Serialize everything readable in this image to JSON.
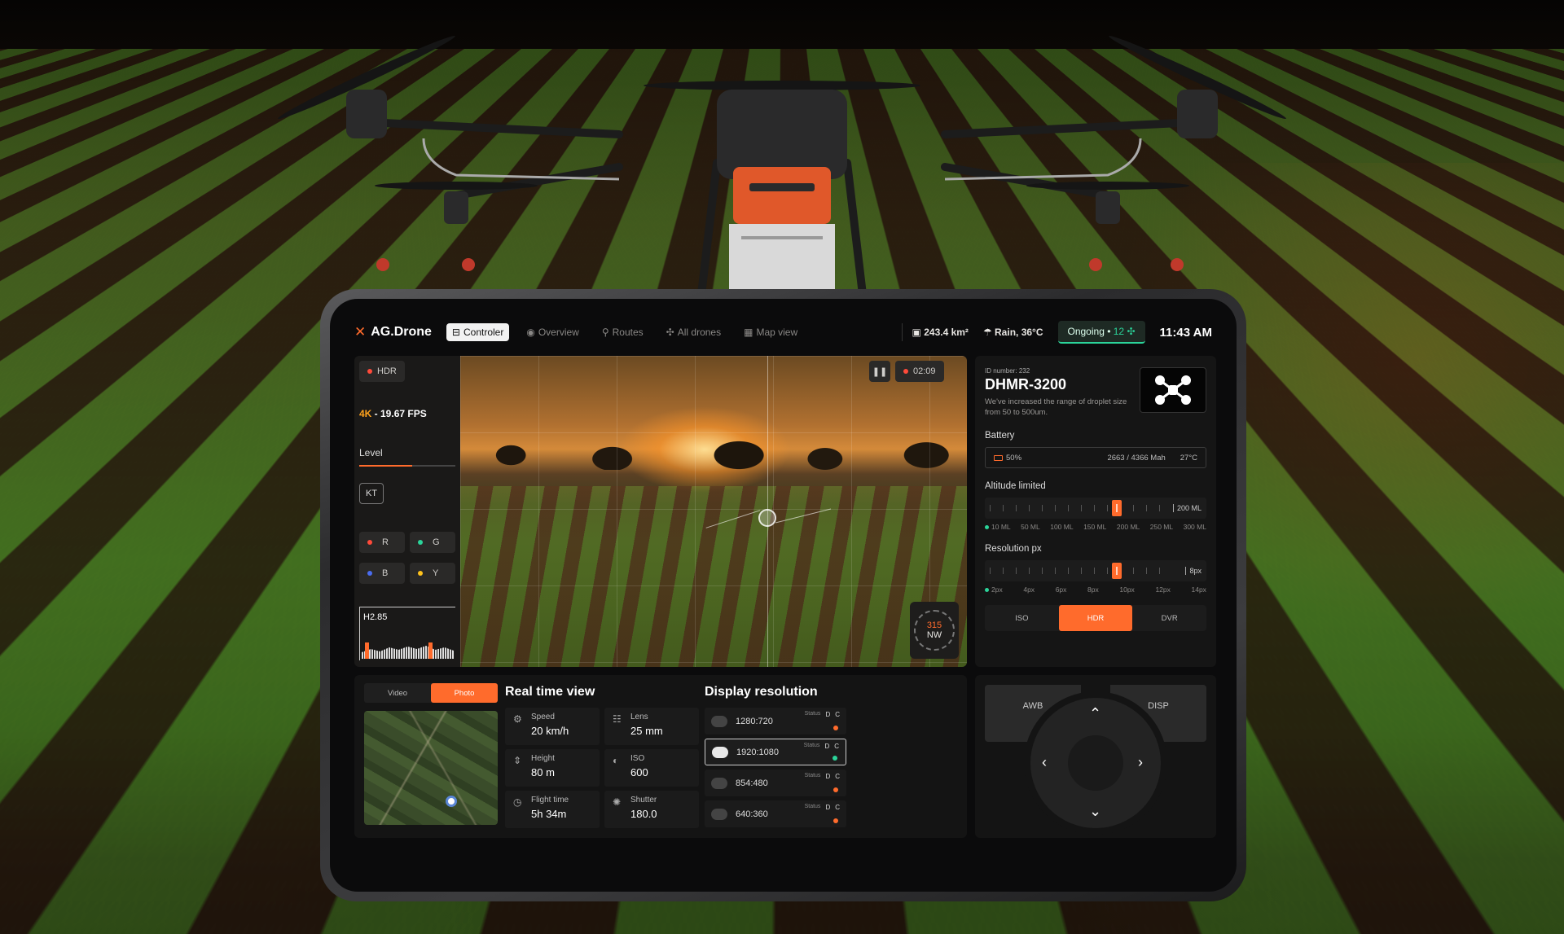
{
  "app": {
    "logo": "AG.Drone"
  },
  "nav": [
    {
      "label": "Controler",
      "icon": "gamepad-icon",
      "active": true
    },
    {
      "label": "Overview",
      "icon": "eye-icon"
    },
    {
      "label": "Routes",
      "icon": "route-icon"
    },
    {
      "label": "All drones",
      "icon": "drone-icon"
    },
    {
      "label": "Map view",
      "icon": "map-icon"
    }
  ],
  "status": {
    "area": "243.4 km²",
    "weather": "Rain, 36°C",
    "ongoing_label": "Ongoing •",
    "ongoing_count": "12",
    "time": "11:43 AM"
  },
  "camera": {
    "hdr_chip": "HDR",
    "recording_time": "02:09",
    "resolution": "4K",
    "fps": " - 19.67 FPS",
    "level_label": "Level",
    "level_fraction": 0.55,
    "kt_button": "KT",
    "channels": [
      "R",
      "G",
      "B",
      "Y"
    ],
    "channel_colors": [
      "#ff4a3a",
      "#2bd49a",
      "#4a6cf0",
      "#ffc21c"
    ],
    "histogram_label": "H2.85",
    "compass_degrees": "315",
    "compass_dir": "NW"
  },
  "drone_info": {
    "id_label": "ID number:",
    "id_value": "232",
    "model": "DHMR-3200",
    "description": "We've increased the range of droplet size from 50 to 500um.",
    "battery_label": "Battery",
    "battery_pct": "50%",
    "battery_capacity": "2663 / 4366 Mah",
    "battery_temp": "27°C",
    "altitude_label": "Altitude limited",
    "altitude_value": "200 ML",
    "altitude_scale": [
      "10 ML",
      "50 ML",
      "100 ML",
      "150 ML",
      "200 ML",
      "250 ML",
      "300 ML"
    ],
    "resolution_label": "Resolution px",
    "resolution_value": "8px",
    "resolution_scale": [
      "2px",
      "4px",
      "6px",
      "8px",
      "10px",
      "12px",
      "14px"
    ],
    "modes": [
      "ISO",
      "HDR",
      "DVR"
    ],
    "active_mode": "HDR"
  },
  "realtime": {
    "toggle": [
      "Video",
      "Photo"
    ],
    "active_toggle": "Photo",
    "title": "Real time view",
    "metrics": [
      {
        "label": "Speed",
        "value": "20 km/h",
        "icon": "speed-icon"
      },
      {
        "label": "Lens",
        "value": "25 mm",
        "icon": "lens-icon"
      },
      {
        "label": "Height",
        "value": "80 m",
        "icon": "height-icon"
      },
      {
        "label": "ISO",
        "value": "600",
        "icon": "iso-icon"
      },
      {
        "label": "Flight time",
        "value": "5h 34m",
        "icon": "clock-icon"
      },
      {
        "label": "Shutter",
        "value": "180.0",
        "icon": "shutter-icon"
      }
    ]
  },
  "display": {
    "title": "Display resolution",
    "status_label": "Status",
    "status_cols": [
      "D",
      "C"
    ],
    "options": [
      {
        "label": "1280:720",
        "selected": false
      },
      {
        "label": "1920:1080",
        "selected": true
      },
      {
        "label": "854:480",
        "selected": false
      },
      {
        "label": "640:360",
        "selected": false
      }
    ]
  },
  "controls": {
    "left_key": "AWB",
    "right_key": "DISP"
  },
  "colors": {
    "accent": "#ff6b2c",
    "success": "#2bd49a"
  }
}
